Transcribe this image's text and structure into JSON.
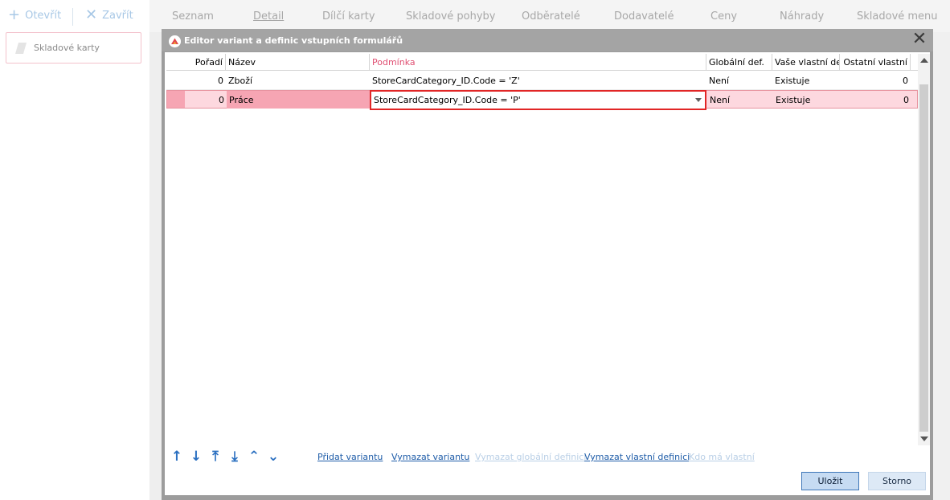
{
  "toolbar": {
    "open_label": "Otevřít",
    "close_label": "Zavřít"
  },
  "left_panel": {
    "item_label": "Skladové karty"
  },
  "app_tabs": [
    {
      "label": "Seznam"
    },
    {
      "label": "Detail"
    },
    {
      "label": "Dílčí karty"
    },
    {
      "label": "Skladové pohyby"
    },
    {
      "label": "Odběratelé"
    },
    {
      "label": "Dodavatelé"
    },
    {
      "label": "Ceny"
    },
    {
      "label": "Náhrady"
    },
    {
      "label": "Skladové menu"
    }
  ],
  "dialog": {
    "title": "Editor variant a definic vstupních formulářů",
    "columns": {
      "order": "Pořadí",
      "name": "Název",
      "condition": "Podmínka",
      "global_def": "Globální def.",
      "own_def": "Vaše vlastní def.",
      "other_own": "Ostatní vlastní"
    },
    "rows": [
      {
        "order": "0",
        "name": "Zboží",
        "condition": "StoreCardCategory_ID.Code = 'Z'",
        "global_def": "Není",
        "own_def": "Existuje",
        "other_own": "0"
      },
      {
        "order": "0",
        "name": "Práce",
        "condition": "StoreCardCategory_ID.Code = 'P'",
        "global_def": "Není",
        "own_def": "Existuje",
        "other_own": "0"
      }
    ],
    "links": {
      "add_variant": "Přidat variantu",
      "delete_variant": "Vymazat variantu",
      "delete_global": "Vymazat globální definici",
      "delete_own": "Vymazat vlastní definici",
      "who_has_own": "Kdo má vlastní"
    },
    "buttons": {
      "save": "Uložit",
      "cancel": "Storno"
    }
  },
  "colors": {
    "selected_row": "#fdd8df",
    "selected_lead": "#f6a5b3",
    "highlight_border": "#e12626",
    "link": "#1e5ca8",
    "header_accent": "#e04f72"
  }
}
